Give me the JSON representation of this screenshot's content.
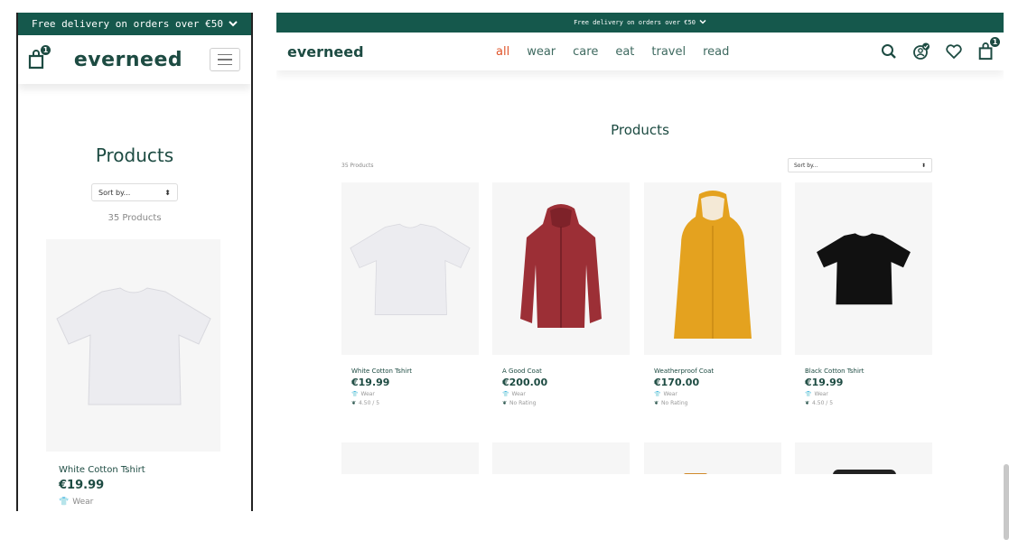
{
  "banner": {
    "text": "Free delivery on orders over €50"
  },
  "brand": {
    "logo": "everneed"
  },
  "cart": {
    "count": "1"
  },
  "nav": {
    "items": [
      "all",
      "wear",
      "care",
      "eat",
      "travel",
      "read"
    ],
    "active": "all"
  },
  "page": {
    "title": "Products"
  },
  "sort": {
    "label": "Sort by..."
  },
  "count": {
    "label": "35 Products"
  },
  "mobile_product": {
    "name": "White Cotton Tshirt",
    "price": "€19.99",
    "category": "Wear"
  },
  "products": [
    {
      "name": "White Cotton Tshirt",
      "price": "€19.99",
      "category": "Wear",
      "rating": "4.50 / 5",
      "image_icon": "white-tshirt"
    },
    {
      "name": "A Good Coat",
      "price": "€200.00",
      "category": "Wear",
      "rating": "No Rating",
      "image_icon": "red-jacket"
    },
    {
      "name": "Weatherproof Coat",
      "price": "€170.00",
      "category": "Wear",
      "rating": "No Rating",
      "image_icon": "yellow-raincoat"
    },
    {
      "name": "Black Cotton Tshirt",
      "price": "€19.99",
      "category": "Wear",
      "rating": "4.50 / 5",
      "image_icon": "black-tshirt"
    }
  ],
  "colors": {
    "brand_dark": "#15584c",
    "accent": "#e0552b",
    "text": "#1d4b42"
  }
}
